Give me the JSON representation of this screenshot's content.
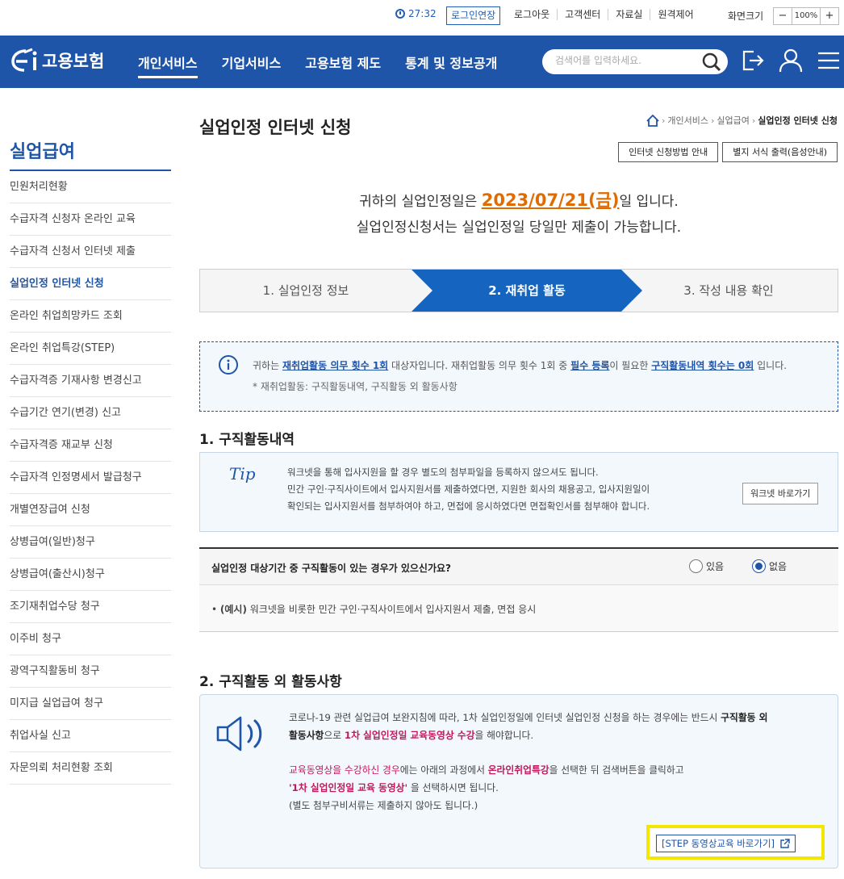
{
  "util": {
    "timer": "27:32",
    "extend": "로그인연장",
    "links": [
      "로그아웃",
      "고객센터",
      "자료실",
      "원격제어"
    ],
    "screen_label": "화면크기",
    "zoom_minus": "−",
    "zoom_value": "100%",
    "zoom_plus": "+"
  },
  "header": {
    "logo_text": "고용보험",
    "menu": [
      "개인서비스",
      "기업서비스",
      "고용보험 제도",
      "통계 및 정보공개"
    ],
    "active_menu": 0,
    "search_placeholder": "검색어를 입력하세요."
  },
  "lnb": {
    "title": "실업급여",
    "items": [
      "민원처리현황",
      "수급자격 신청자 온라인 교육",
      "수급자격 신청서 인터넷 제출",
      "실업인정 인터넷 신청",
      "온라인 취업희망카드 조회",
      "온라인 취업특강(STEP)",
      "수급자격증 기재사항 변경신고",
      "수급기간 연기(변경) 신고",
      "수급자격증 재교부 신청",
      "수급자격 인정명세서 발급청구",
      "개별연장급여 신청",
      "상병급여(일반)청구",
      "상병급여(출산시)청구",
      "조기재취업수당 청구",
      "이주비 청구",
      "광역구직활동비 청구",
      "미지급 실업급여 청구",
      "취업사실 신고",
      "자문의뢰 처리현황 조회"
    ],
    "active_index": 3
  },
  "page": {
    "title": "실업인정 인터넷 신청",
    "breadcrumb": [
      "개인서비스",
      "실업급여",
      "실업인정 인터넷 신청"
    ],
    "btn_guide": "인터넷 신청방법 안내",
    "btn_print": "별지 서식 출력(음성안내)"
  },
  "notice": {
    "pre": "귀하의 실업인정일은 ",
    "date": "2023/07/21(금)",
    "post": "일 입니다.",
    "line2": "실업인정신청서는 실업인정일 당일만 제출이 가능합니다."
  },
  "steps": [
    "1. 실업인정 정보",
    "2. 재취업 활동",
    "3. 작성 내용 확인"
  ],
  "info": {
    "t1": "귀하는 ",
    "u1": "재취업활동 의무 횟수 1회",
    "t2": " 대상자입니다. 재취업활동 의무 횟수 1회 중 ",
    "u2": "필수 등록",
    "t3": "이 필요한 ",
    "u3": "구직활동내역 횟수는 0회",
    "t4": " 입니다.",
    "line2": "* 재취업활동: 구직활동내역, 구직활동 외 활동사항"
  },
  "section1": {
    "title": "1. 구직활동내역",
    "tip": "Tip",
    "tip_lines": [
      "워크넷을 통해 입사지원을 할 경우 별도의 첨부파일을 등록하지 않으셔도 됩니다.",
      "민간 구인·구직사이트에서 입사지원서를 제출하였다면, 지원한 회사의 채용공고, 입사지원일이",
      "확인되는 입사지원서를 첨부하여야 하고, 면접에 응시하였다면 면접확인서를 첨부해야 합니다."
    ],
    "worknet_btn": "워크넷 바로가기",
    "question": "실업인정 대상기간 중 구직활동이 있는 경우가 있으신가요?",
    "yes": "있음",
    "no": "없음",
    "selected": "no",
    "ex_label": "(예시)",
    "ex_text": " 워크넷을 비롯한 민간 구인·구직사이트에서 입사지원서 제출, 면접 응시"
  },
  "section2": {
    "title": "2. 구직활동 외 활동사항",
    "p1a": "코로나-19 관련 실업급여 보완지침에 따라, 1차 실업인정일에 인터넷 실업인정 신청을 하는 경우에는 반드시 ",
    "p1b": "구직활동 외",
    "p1c": "활동사항",
    "p1d": "으로 ",
    "p1e": "1차 실업인정일 교육동영상 수강",
    "p1f": "을 해야합니다.",
    "p2a": "교육동영상을 수강하신 경우",
    "p2b": "에는 아래의 과정에서 ",
    "p2c": "온라인취업특강",
    "p2d": "을 선택한 뒤 검색버튼을 클릭하고",
    "p3a": "'1차 실업인정일 교육 동영상'",
    "p3b": " 을 선택하시면 됩니다.",
    "p4": "(별도 첨부구비서류는 제출하지 않아도 됩니다.)",
    "step_link": "[STEP 동영상교육 바로가기]"
  },
  "colors": {
    "brand": "#1f55a9",
    "accent": "#e06b00",
    "highlight": "#f3e600"
  }
}
